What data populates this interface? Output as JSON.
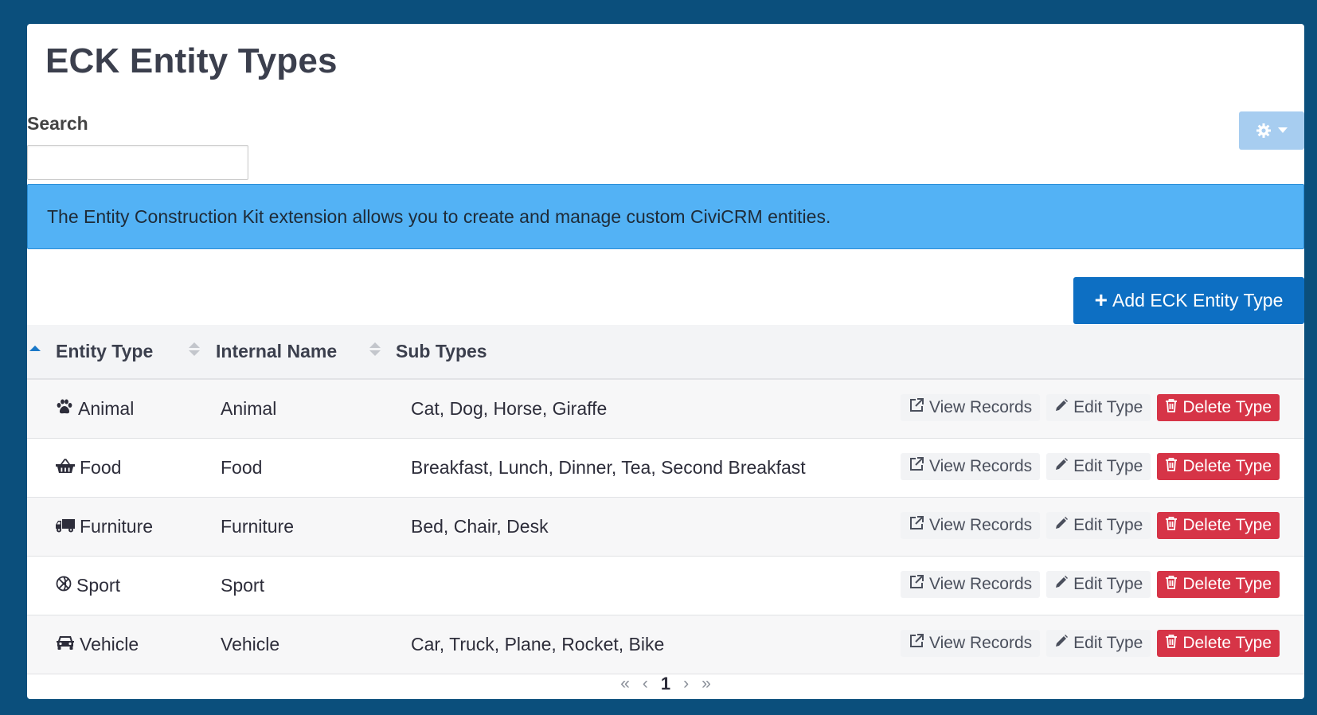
{
  "page": {
    "title": "ECK Entity Types"
  },
  "search": {
    "label": "Search",
    "value": "",
    "placeholder": ""
  },
  "settings_button": {
    "icon": "gear-icon",
    "caret": "caret-down-icon"
  },
  "alert": {
    "text": "The Entity Construction Kit extension allows you to create and manage custom CiviCRM entities."
  },
  "add_button": {
    "label": "Add ECK Entity Type",
    "icon_glyph": "+"
  },
  "table": {
    "columns": [
      "Entity Type",
      "Internal Name",
      "Sub Types"
    ],
    "sorted_column": "Entity Type",
    "sort_direction": "ascending",
    "action_labels": {
      "view": "View Records",
      "edit": "Edit Type",
      "delete": "Delete Type"
    },
    "rows": [
      {
        "icon": "paw-icon",
        "entity_type": "Animal",
        "internal_name": "Animal",
        "sub_types": "Cat, Dog, Horse, Giraffe"
      },
      {
        "icon": "basket-icon",
        "entity_type": "Food",
        "internal_name": "Food",
        "sub_types": "Breakfast, Lunch, Dinner, Tea, Second Breakfast"
      },
      {
        "icon": "truck-icon",
        "entity_type": "Furniture",
        "internal_name": "Furniture",
        "sub_types": "Bed, Chair, Desk"
      },
      {
        "icon": "ball-icon",
        "entity_type": "Sport",
        "internal_name": "Sport",
        "sub_types": ""
      },
      {
        "icon": "car-icon",
        "entity_type": "Vehicle",
        "internal_name": "Vehicle",
        "sub_types": "Car, Truck, Plane, Rocket, Bike"
      }
    ]
  },
  "pagination": {
    "first": "«",
    "prev": "‹",
    "current": "1",
    "next": "›",
    "last": "»"
  },
  "colors": {
    "header_bar": "#0b4f7c",
    "alert_bg": "#53b2f5",
    "primary": "#0d6fc3",
    "danger": "#d63447"
  }
}
